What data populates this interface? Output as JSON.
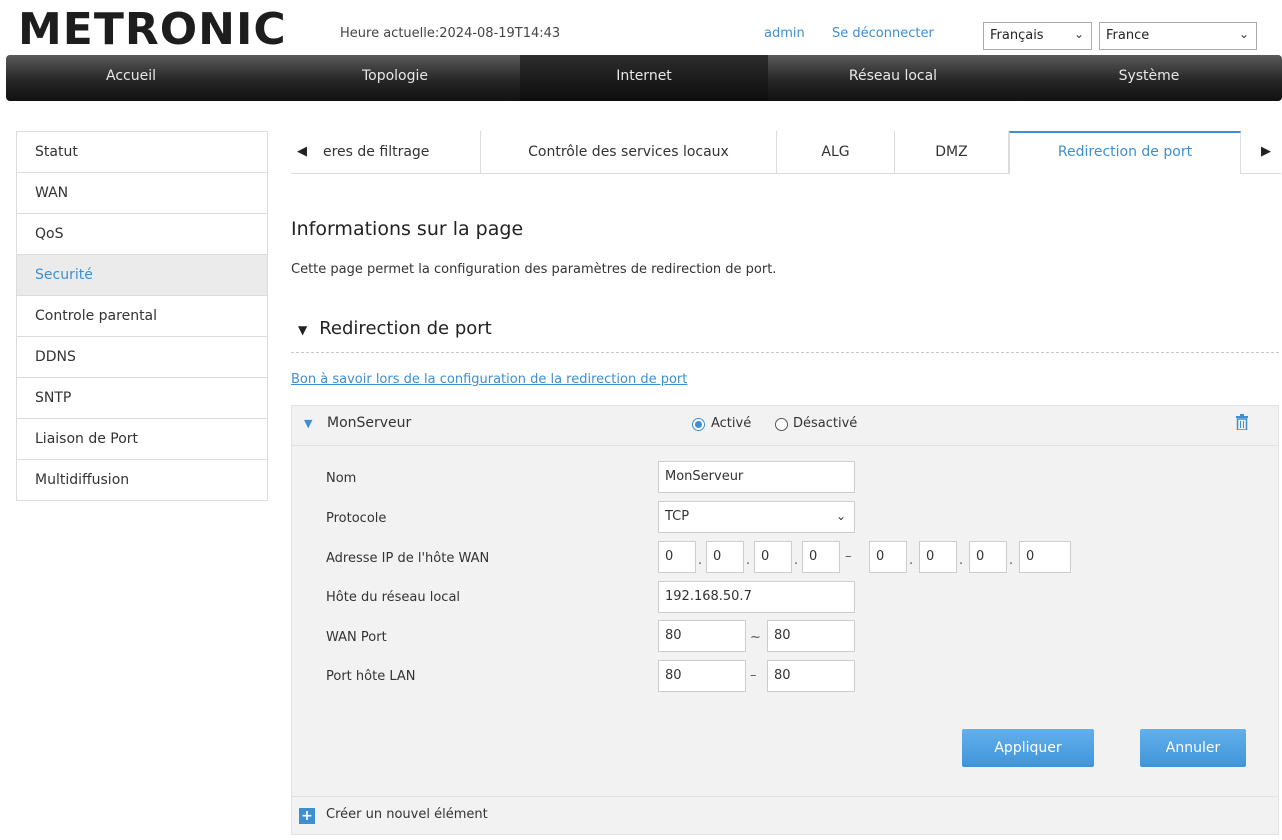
{
  "header": {
    "logo": "METRONIC",
    "time": "Heure actuelle:2024-08-19T14:43",
    "user": "admin",
    "logout": "Se déconnecter",
    "language": "Français",
    "country": "France"
  },
  "nav": [
    "Accueil",
    "Topologie",
    "Internet",
    "Réseau local",
    "Système"
  ],
  "sidebar": [
    "Statut",
    "WAN",
    "QoS",
    "Securité",
    "Controle parental",
    "DDNS",
    "SNTP",
    "Liaison de Port",
    "Multidiffusion"
  ],
  "tabs": [
    "eres de filtrage",
    "Contrôle des services locaux",
    "ALG",
    "DMZ",
    "Redirection de port"
  ],
  "page": {
    "title": "Informations sur la page",
    "description": "Cette page permet la configuration des paramètres de redirection de port.",
    "section": "Redirection de port",
    "help_link": "Bon à savoir lors de la configuration de la redirection de port"
  },
  "entry": {
    "name": "MonServeur",
    "enabled_label": "Activé",
    "disabled_label": "Désactivé",
    "status": "enabled"
  },
  "form": {
    "labels": [
      "Nom",
      "Protocole",
      "Adresse IP de l'hôte WAN",
      "Hôte du réseau local",
      "WAN Port",
      "Port hôte LAN"
    ],
    "name_value": "MonServeur",
    "protocol": "TCP",
    "wan_ip_start": [
      "0",
      "0",
      "0",
      "0"
    ],
    "wan_ip_end": [
      "0",
      "0",
      "0",
      "0"
    ],
    "lan_host": "192.168.50.7",
    "wan_port_start": "80",
    "wan_port_end": "80",
    "lan_port_start": "80",
    "lan_port_end": "80"
  },
  "buttons": {
    "apply": "Appliquer",
    "cancel": "Annuler"
  },
  "create_label": "Créer un nouvel élément",
  "colors": {
    "accent": "#3d8fd1",
    "nav_bg": "#262626",
    "panel_bg": "#f2f2f2"
  }
}
